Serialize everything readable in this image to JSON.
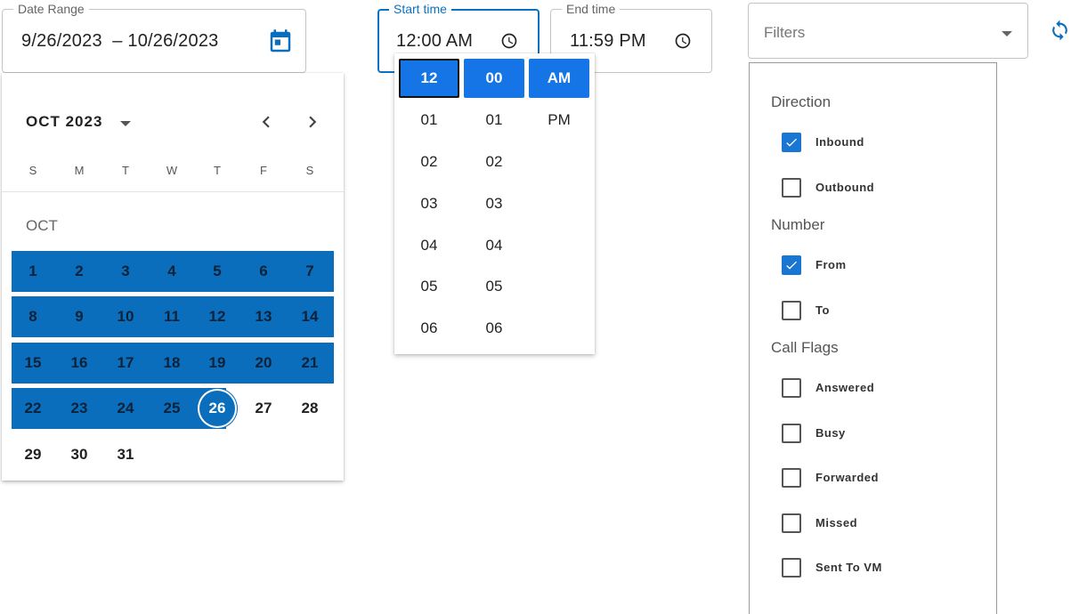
{
  "date_range": {
    "legend": "Date Range",
    "value": "9/26/2023  – 10/26/2023",
    "icon": "calendar-icon"
  },
  "start_time": {
    "legend": "Start time",
    "value": "12:00 AM",
    "icon": "clock-icon"
  },
  "end_time": {
    "legend": "End time",
    "value": "11:59 PM",
    "icon": "clock-icon"
  },
  "filters_select": {
    "placeholder": "Filters",
    "icon": "chevron-down-icon"
  },
  "refresh": {
    "icon": "refresh-icon"
  },
  "calendar": {
    "month_label": "OCT 2023",
    "sub_month": "OCT",
    "weekdays": [
      "S",
      "M",
      "T",
      "W",
      "T",
      "F",
      "S"
    ],
    "weeks": [
      [
        "1",
        "2",
        "3",
        "4",
        "5",
        "6",
        "7"
      ],
      [
        "8",
        "9",
        "10",
        "11",
        "12",
        "13",
        "14"
      ],
      [
        "15",
        "16",
        "17",
        "18",
        "19",
        "20",
        "21"
      ],
      [
        "22",
        "23",
        "24",
        "25",
        "26",
        "27",
        "28"
      ],
      [
        "29",
        "30",
        "31"
      ]
    ],
    "range_start_day": 1,
    "range_end_day": 26,
    "accent_color": "#0a6ebd"
  },
  "time_picker": {
    "hours": [
      "12",
      "01",
      "02",
      "03",
      "04",
      "05",
      "06"
    ],
    "minutes": [
      "00",
      "01",
      "02",
      "03",
      "04",
      "05",
      "06"
    ],
    "meridiem": [
      "AM",
      "PM"
    ],
    "selected_hour": "12",
    "selected_minute": "00",
    "selected_meridiem": "AM",
    "accent_color": "#1575e6"
  },
  "filters_panel": {
    "sections": [
      {
        "title": "Direction",
        "options": [
          {
            "label": "Inbound",
            "checked": true
          },
          {
            "label": "Outbound",
            "checked": false
          }
        ]
      },
      {
        "title": "Number",
        "options": [
          {
            "label": "From",
            "checked": true
          },
          {
            "label": "To",
            "checked": false
          }
        ]
      },
      {
        "title": "Call Flags",
        "options": [
          {
            "label": "Answered",
            "checked": false
          },
          {
            "label": "Busy",
            "checked": false
          },
          {
            "label": "Forwarded",
            "checked": false
          },
          {
            "label": "Missed",
            "checked": false
          },
          {
            "label": "Sent To VM",
            "checked": false
          }
        ]
      }
    ]
  }
}
